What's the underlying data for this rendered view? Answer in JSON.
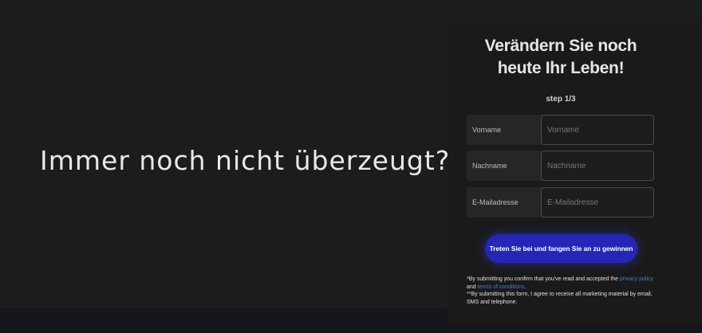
{
  "main": {
    "headline": "Immer noch nicht überzeugt?"
  },
  "form": {
    "title_line1": "Verändern Sie noch",
    "title_line2": "heute Ihr Leben!",
    "step": "step 1/3",
    "fields": [
      {
        "label": "Vorname",
        "placeholder": "Vorname"
      },
      {
        "label": "Nachname",
        "placeholder": "Nachname"
      },
      {
        "label": "E-Mailadresse",
        "placeholder": "E-Mailadresse"
      }
    ],
    "submit_label": "Treten Sie bei und fangen Sie an zu gewinnen",
    "legal": {
      "line1_prefix": "*By submitting you confirm that you've read and accepted the",
      "privacy_link": "privacy policy",
      "and_text": "and",
      "terms_link": "terms of conditions",
      "line1_suffix": ".",
      "line2": "**By submitting this form, I agree to receive all marketing material by email, SMS and telephone."
    }
  },
  "colors": {
    "background": "#1b1c1d",
    "panel": "#1a1a1a",
    "button": "#2427b5",
    "link": "#3e7ce8"
  }
}
